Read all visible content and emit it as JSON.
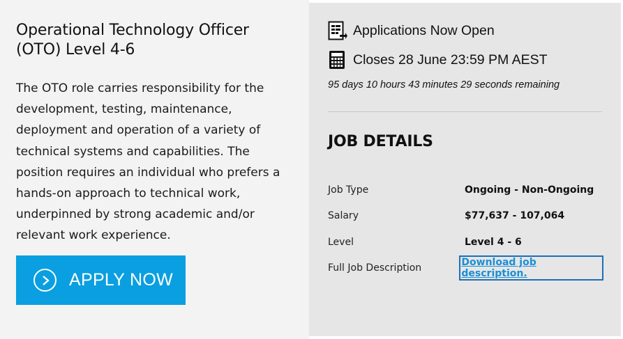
{
  "job": {
    "title": "Operational Technology Officer (OTO) Level 4-6",
    "description": "The OTO role carries responsibility for the development, testing, maintenance, deployment and operation of a variety of technical systems and capabilities. The position requires an individual who prefers a hands-on approach to technical work, underpinned by strong academic and/or relevant work experience.",
    "apply_label": "APPLY NOW"
  },
  "status": {
    "open_text": "Applications Now Open",
    "closes_text": "Closes 28 June 23:59 PM AEST",
    "remaining_text": "95 days 10 hours 43 minutes 29 seconds remaining"
  },
  "details": {
    "heading": "JOB DETAILS",
    "rows": [
      {
        "key": "Job Type",
        "value": "Ongoing - Non-Ongoing"
      },
      {
        "key": "Salary",
        "value": "$77,637 - 107,064"
      },
      {
        "key": "Level",
        "value": "Level 4 - 6"
      },
      {
        "key": "Full Job Description",
        "value": "Download job description."
      }
    ]
  },
  "icons": {
    "apply": "chevron-right-circle-icon",
    "open": "document-arrow-icon",
    "closes": "calculator-icon"
  },
  "colors": {
    "apply_bg": "#0a9fe0",
    "link": "#1a8fd6",
    "left_panel": "#f3f3f3",
    "right_panel": "#e6e6e6"
  }
}
